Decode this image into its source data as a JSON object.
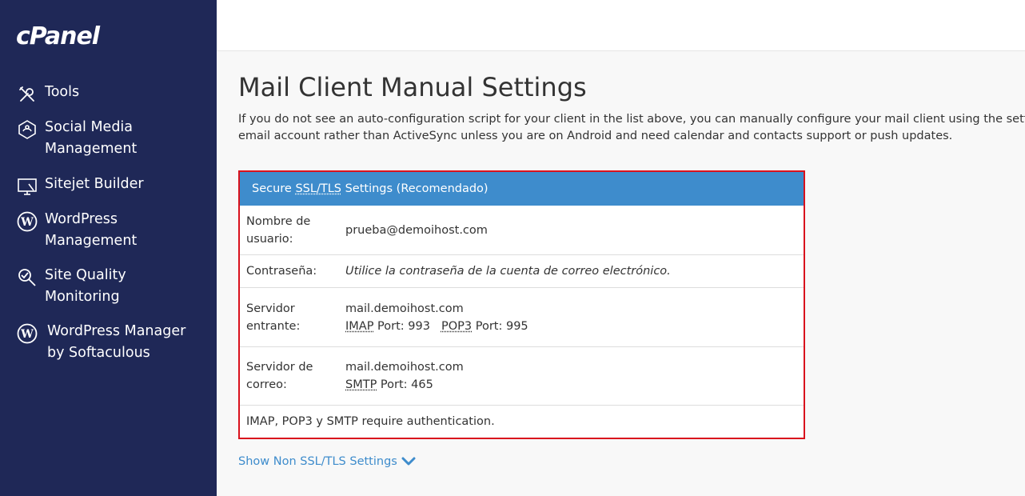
{
  "sidebar": {
    "logo": "cPanel",
    "items": [
      {
        "label": "Tools"
      },
      {
        "label": "Social Media\nManagement"
      },
      {
        "label": "Sitejet Builder"
      },
      {
        "label": "WordPress\nManagement"
      },
      {
        "label": "Site Quality\nMonitoring"
      },
      {
        "label": "WordPress Manager\nby Softaculous"
      }
    ]
  },
  "main": {
    "title": "Mail Client Manual Settings",
    "intro_line1": "If you do not see an auto-configuration script for your client in the list above, you can manually configure your mail client using the settings",
    "intro_line2": "email account rather than ActiveSync unless you are on Android and need calendar and contacts support or push updates.",
    "settings": {
      "header_ssl": "SSL/TLS",
      "header_prefix": "Secure ",
      "header_suffix": " Settings (Recomendado)",
      "rows": {
        "username_label": "Nombre de\nusuario:",
        "username_value": "prueba@demoihost.com",
        "password_label": "Contraseña:",
        "password_value": "Utilice la contraseña de la cuenta de correo electrónico.",
        "incoming_label": "Servidor\nentrante:",
        "incoming_host": "mail.demoihost.com",
        "imap": "IMAP",
        "imap_port": " Port: 993",
        "pop3": "POP3",
        "pop3_port": " Port: 995",
        "outgoing_label": "Servidor de\ncorreo:",
        "outgoing_host": "mail.demoihost.com",
        "smtp": "SMTP",
        "smtp_port": " Port: 465",
        "auth_note": "IMAP, POP3 y SMTP require authentication."
      }
    },
    "toggle_link": "Show Non SSL/TLS Settings"
  }
}
